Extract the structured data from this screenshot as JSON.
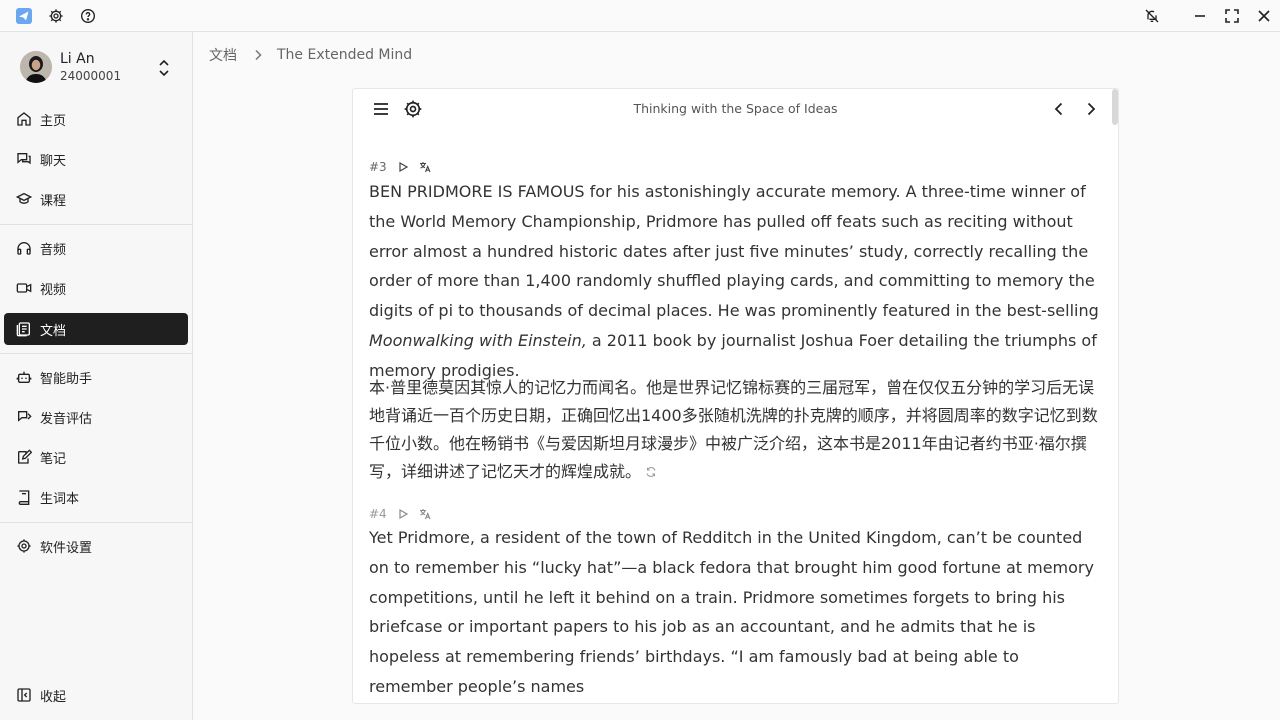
{
  "titlebar": {
    "app_icon": "send-icon",
    "settings_icon": "gear-icon",
    "help_icon": "help-icon",
    "controls": [
      "bell-off-icon",
      "minimize-icon",
      "fullscreen-icon",
      "close-icon"
    ]
  },
  "user": {
    "name": "Li An",
    "id": "24000001"
  },
  "sidebar": {
    "items": [
      {
        "label": "主页",
        "icon": "home-icon"
      },
      {
        "label": "聊天",
        "icon": "chat-icon"
      },
      {
        "label": "课程",
        "icon": "graduation-cap-icon"
      },
      {
        "label": "音频",
        "icon": "headphones-icon"
      },
      {
        "label": "视频",
        "icon": "video-icon"
      },
      {
        "label": "文档",
        "icon": "document-icon",
        "active": true
      },
      {
        "label": "智能助手",
        "icon": "bot-icon"
      },
      {
        "label": "发音评估",
        "icon": "speech-icon"
      },
      {
        "label": "笔记",
        "icon": "note-icon"
      },
      {
        "label": "生词本",
        "icon": "book-icon"
      },
      {
        "label": "软件设置",
        "icon": "gear-icon"
      }
    ],
    "collapse_label": "收起"
  },
  "breadcrumb": {
    "root": "文档",
    "current": "The Extended Mind"
  },
  "reader": {
    "title": "Thinking with the Space of Ideas",
    "paragraphs": [
      {
        "number": "#3",
        "en_before": "BEN PRIDMORE IS FAMOUS for his astonishingly accurate memory. A three-time winner of the World Memory Championship, Pridmore has pulled off feats such as reciting without error almost a hundred historic dates after just five minutes’ study, correctly recalling the order of more than 1,400 randomly shuffled playing cards, and committing to memory the digits of pi to thousands of decimal places. He was prominently featured in the best-selling ",
        "en_italic": "Moonwalking with Einstein,",
        "en_after": " a 2011 book by journalist Joshua Foer detailing the triumphs of memory prodigies.",
        "zh": "本·普里德莫因其惊人的记忆力而闻名。他是世界记忆锦标赛的三届冠军，曾在仅仅五分钟的学习后无误地背诵近一百个历史日期，正确回忆出1400多张随机洗牌的扑克牌的顺序，并将圆周率的数字记忆到数千位小数。他在畅销书《与爱因斯坦月球漫步》中被广泛介绍，这本书是2011年由记者约书亚·福尔撰写，详细讲述了记忆天才的辉煌成就。"
      },
      {
        "number": "#4",
        "en": "Yet Pridmore, a resident of the town of Redditch in the United Kingdom, can’t be counted on to remember his “lucky hat”—a black fedora that brought him good fortune at memory competitions, until he left it behind on a train. Pridmore sometimes forgets to bring his briefcase or important papers to his job as an accountant, and he admits that he is hopeless at remembering friends’ birthdays. “I am famously bad at being able to remember people’s names"
      }
    ]
  }
}
